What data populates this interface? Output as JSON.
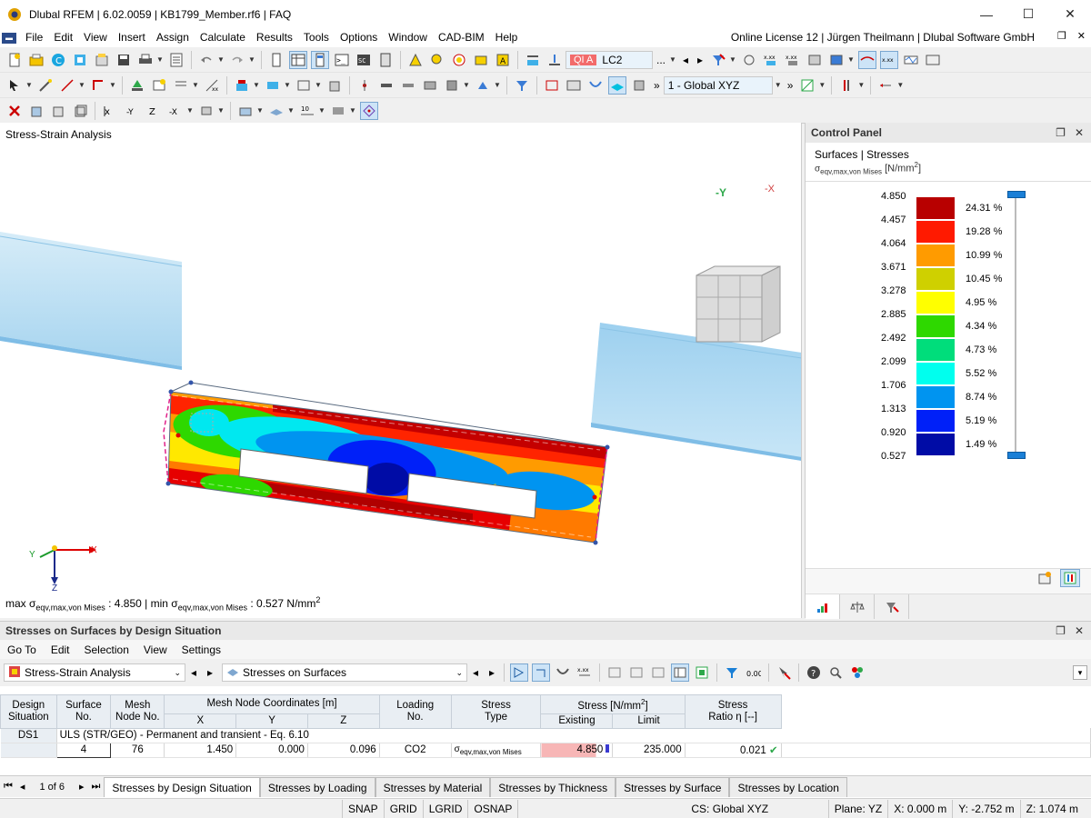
{
  "window": {
    "title": "Dlubal RFEM | 6.02.0059 | KB1799_Member.rf6 | FAQ",
    "minimize": "—",
    "maximize": "☐",
    "close": "✕"
  },
  "menu": {
    "items": [
      "File",
      "Edit",
      "View",
      "Insert",
      "Assign",
      "Calculate",
      "Results",
      "Tools",
      "Options",
      "Window",
      "CAD-BIM",
      "Help"
    ],
    "license": "Online License 12 | Jürgen Theilmann | Dlubal Software GmbH"
  },
  "toolbar": {
    "load_case_tag": "QI A",
    "load_case": "LC2",
    "coord_system": "1 - Global XYZ",
    "more": "..."
  },
  "viewport": {
    "title": "Stress-Strain Analysis",
    "axis_labels": {
      "x": "X",
      "y": "Y",
      "z": "Z"
    },
    "cube_labels": {
      "front": "-Y",
      "side": "-X"
    },
    "footer_prefix": "max ",
    "footer_max_sym": "σ",
    "footer_max_sub": "eqv,max,von Mises",
    "footer_max_val": " : 4.850 | min ",
    "footer_min_sym": "σ",
    "footer_min_sub": "eqv,max,von Mises",
    "footer_min_val": " : 0.527 N/mm",
    "footer_exp": "2"
  },
  "control_panel": {
    "title": "Control Panel",
    "subtitle": "Surfaces | Stresses",
    "quantity_sym": "σ",
    "quantity_sub": "eqv,max,von Mises",
    "quantity_unit": " [N/mm",
    "quantity_exp": "2",
    "quantity_close": "]",
    "legend_values": [
      "4.850",
      "4.457",
      "4.064",
      "3.671",
      "3.278",
      "2.885",
      "2.492",
      "2.099",
      "1.706",
      "1.313",
      "0.920",
      "0.527"
    ],
    "legend_bands": [
      {
        "color": "#b80000",
        "pct": "24.31 %"
      },
      {
        "color": "#ff1a00",
        "pct": "19.28 %"
      },
      {
        "color": "#ff9b00",
        "pct": "10.99 %"
      },
      {
        "color": "#cfd000",
        "pct": "10.45 %"
      },
      {
        "color": "#ffff00",
        "pct": "4.95 %"
      },
      {
        "color": "#2ed800",
        "pct": "4.34 %"
      },
      {
        "color": "#00dd7b",
        "pct": "4.73 %"
      },
      {
        "color": "#00ffee",
        "pct": "5.52 %"
      },
      {
        "color": "#0094f0",
        "pct": "8.74 %"
      },
      {
        "color": "#0020f8",
        "pct": "5.19 %"
      },
      {
        "color": "#000ca6",
        "pct": "1.49 %"
      }
    ]
  },
  "table_panel": {
    "title": "Stresses on Surfaces by Design Situation",
    "menu": [
      "Go To",
      "Edit",
      "Selection",
      "View",
      "Settings"
    ],
    "analysis_select": "Stress-Strain Analysis",
    "result_select": "Stresses on Surfaces",
    "headers": {
      "design_situation": [
        "Design",
        "Situation"
      ],
      "surface_no": [
        "Surface",
        "No."
      ],
      "mesh_node": [
        "Mesh",
        "Node No."
      ],
      "coords_group": "Mesh Node Coordinates [m]",
      "x": "X",
      "y": "Y",
      "z": "Z",
      "loading": [
        "Loading",
        "No."
      ],
      "stress_type": [
        "Stress",
        "Type"
      ],
      "stress_group_prefix": "Stress [N/mm",
      "stress_group_exp": "2",
      "stress_group_suffix": "]",
      "existing": "Existing",
      "limit": "Limit",
      "ratio": [
        "Stress",
        "Ratio η [--]"
      ]
    },
    "group_row": {
      "ds": "DS1",
      "label": "ULS (STR/GEO) - Permanent and transient - Eq. 6.10"
    },
    "rows": [
      {
        "surface": "4",
        "node": "76",
        "x": "1.450",
        "y": "0.000",
        "z": "0.096",
        "loading": "CO2",
        "type_sym": "σ",
        "type_sub": "eqv,max,von Mises",
        "existing": "4.850",
        "limit": "235.000",
        "ratio": "0.021"
      }
    ]
  },
  "bottom_tabs": {
    "pager": "1 of 6",
    "items": [
      "Stresses by Design Situation",
      "Stresses by Loading",
      "Stresses by Material",
      "Stresses by Thickness",
      "Stresses by Surface",
      "Stresses by Location"
    ],
    "active": 0
  },
  "status": {
    "toggles": [
      "SNAP",
      "GRID",
      "LGRID",
      "OSNAP"
    ],
    "cs": "CS: Global XYZ",
    "plane": "Plane: YZ",
    "x": "X: 0.000 m",
    "y": "Y: -2.752 m",
    "z": "Z: 1.074 m"
  }
}
